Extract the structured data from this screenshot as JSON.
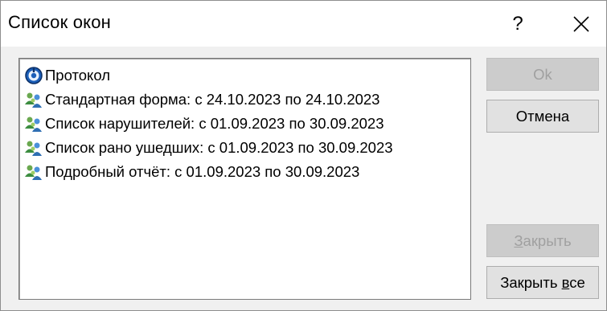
{
  "window": {
    "title": "Список окон",
    "help_label": "?"
  },
  "list": {
    "items": [
      {
        "label": "Протокол",
        "icon": "protocol-icon"
      },
      {
        "label": "Стандартная форма: с 24.10.2023 по 24.10.2023",
        "icon": "users-group-icon"
      },
      {
        "label": "Список нарушителей: с 01.09.2023 по 30.09.2023",
        "icon": "users-group-icon"
      },
      {
        "label": "Список рано ушедших: с 01.09.2023 по 30.09.2023",
        "icon": "users-group-icon"
      },
      {
        "label": "Подробный отчёт: с 01.09.2023 по 30.09.2023",
        "icon": "users-group-icon"
      }
    ]
  },
  "buttons": {
    "ok": "Ok",
    "cancel": "Отмена",
    "close_first": "З",
    "close_rest": "акрыть",
    "close_all_prefix": "Закрыть ",
    "close_all_underlined": "в",
    "close_all_suffix": "се"
  },
  "colors": {
    "title_bg": "#ffffff",
    "dialog_bg": "#f0f0f0",
    "button_bg": "#e1e1e1",
    "disabled_text": "#a0a0a0"
  }
}
